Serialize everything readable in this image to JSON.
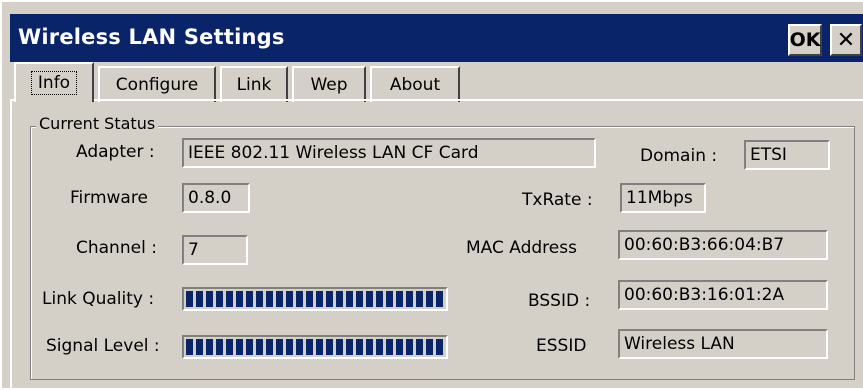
{
  "window": {
    "title": "Wireless LAN Settings",
    "ok_label": "OK",
    "close_label": "✕"
  },
  "tabs": [
    {
      "label": "Info",
      "active": true
    },
    {
      "label": "Configure",
      "active": false
    },
    {
      "label": "Link",
      "active": false
    },
    {
      "label": "Wep",
      "active": false
    },
    {
      "label": "About",
      "active": false
    }
  ],
  "status": {
    "group_label": "Current Status",
    "adapter": {
      "label": "Adapter :",
      "value": "IEEE 802.11 Wireless LAN CF Card"
    },
    "domain": {
      "label": "Domain :",
      "value": "ETSI"
    },
    "firmware": {
      "label": "Firmware",
      "value": "0.8.0"
    },
    "txrate": {
      "label": "TxRate :",
      "value": "11Mbps"
    },
    "channel": {
      "label": "Channel :",
      "value": "7"
    },
    "mac": {
      "label": "MAC Address",
      "value": "00:60:B3:66:04:B7"
    },
    "link_quality": {
      "label": "Link Quality :",
      "level": 1.0
    },
    "bssid": {
      "label": "BSSID :",
      "value": "00:60:B3:16:01:2A"
    },
    "signal_level": {
      "label": "Signal Level :",
      "level": 1.0
    },
    "essid": {
      "label": "ESSID",
      "value": "Wireless LAN"
    }
  },
  "colors": {
    "title_bar": "#0a246a",
    "face": "#d4d0c8",
    "bar_fill": "#0a246a"
  }
}
